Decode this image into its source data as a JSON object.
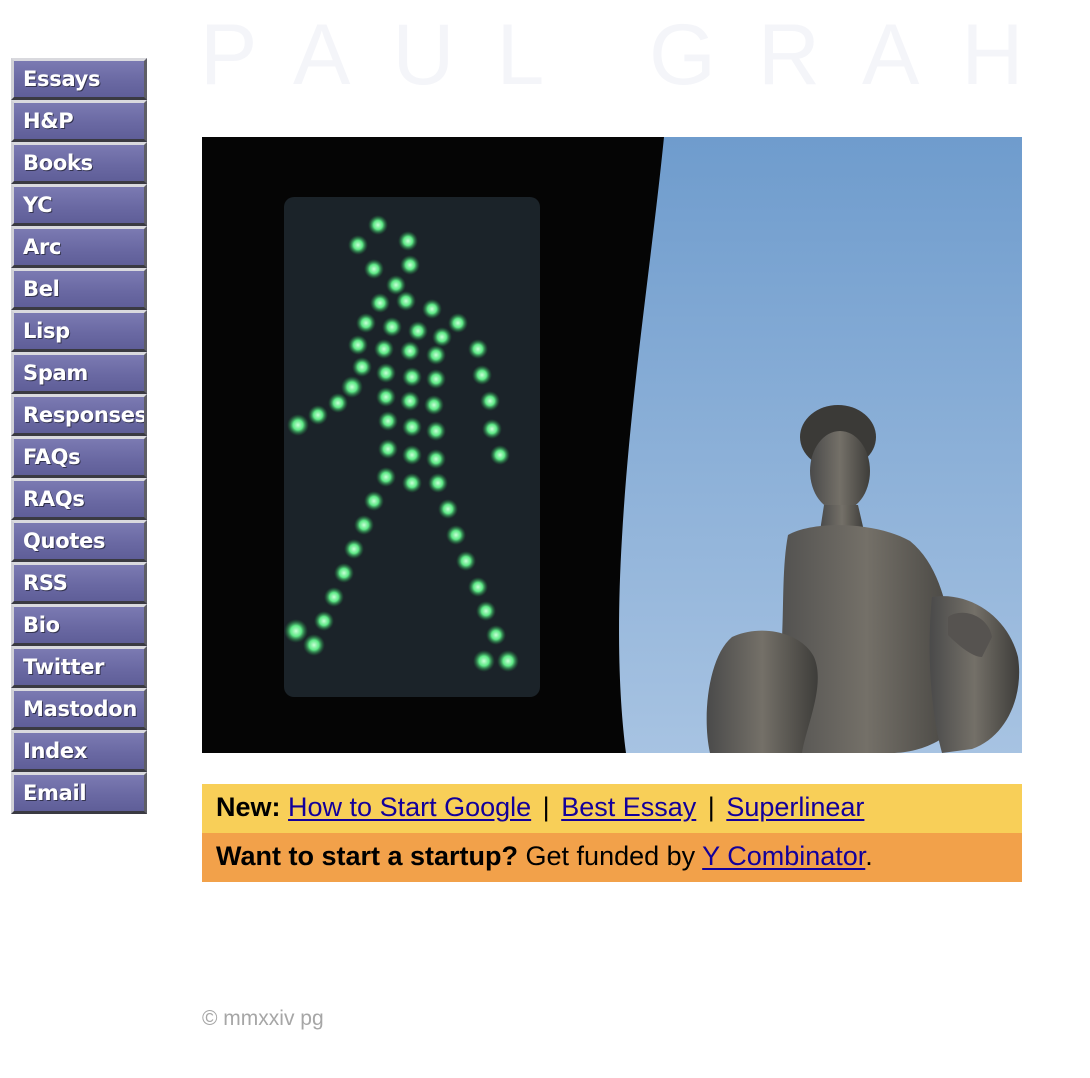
{
  "nav": {
    "items": [
      {
        "label": "Essays"
      },
      {
        "label": "H&P"
      },
      {
        "label": "Books"
      },
      {
        "label": "YC"
      },
      {
        "label": "Arc"
      },
      {
        "label": "Bel"
      },
      {
        "label": "Lisp"
      },
      {
        "label": "Spam"
      },
      {
        "label": "Responses"
      },
      {
        "label": "FAQs"
      },
      {
        "label": "RAQs"
      },
      {
        "label": "Quotes"
      },
      {
        "label": "RSS"
      },
      {
        "label": "Bio"
      },
      {
        "label": "Twitter"
      },
      {
        "label": "Mastodon"
      },
      {
        "label": "Index"
      },
      {
        "label": "Email"
      }
    ],
    "button_color": "#6a69a3"
  },
  "header": {
    "wordmark": "PAUL GRAHAM"
  },
  "hero": {
    "colors": {
      "sky": "#8fb1d6",
      "signal_dots": "#5ee886",
      "housing": "#050505"
    }
  },
  "news": {
    "new_label": "New:",
    "links": [
      {
        "label": "How to Start Google"
      },
      {
        "label": "Best Essay"
      },
      {
        "label": "Superlinear"
      }
    ],
    "separator": "|",
    "bg_color": "#f8cf58"
  },
  "startup": {
    "question": "Want to start a startup?",
    "text": "Get funded by",
    "link": "Y Combinator",
    "end": ".",
    "bg_color": "#f2a14a"
  },
  "footer": {
    "copyright": "© mmxxiv pg"
  }
}
